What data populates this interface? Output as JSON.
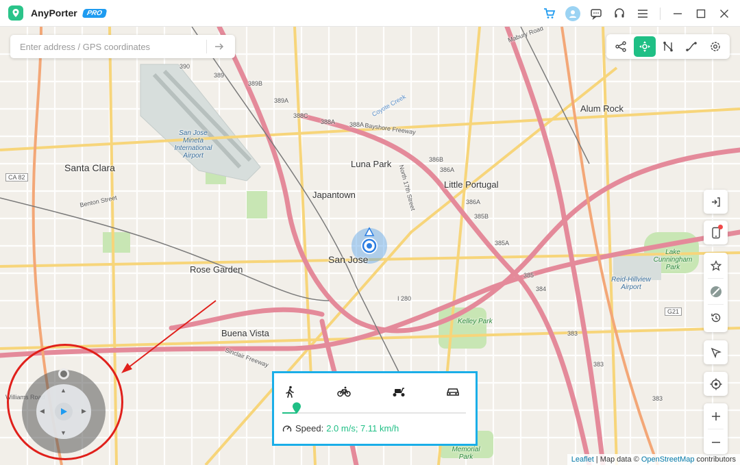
{
  "app": {
    "name": "AnyPorter",
    "badge": "PRO"
  },
  "search": {
    "placeholder": "Enter address / GPS coordinates",
    "value": ""
  },
  "map_labels": {
    "santa_clara": "Santa Clara",
    "san_jose": "San Jose",
    "luna_park": "Luna Park",
    "japantown": "Japantown",
    "little_portugal": "Little Portugal",
    "alum_rock": "Alum Rock",
    "rose_garden": "Rose Garden",
    "buena_vista": "Buena Vista",
    "lake_cunningham": "Lake Cunningham Park",
    "reid_hillview": "Reid-Hillview Airport",
    "kelley_park": "Kelley Park",
    "memorial_park": "Memorial Park",
    "airport": "San Jose Mineta International Airport",
    "bayshore": "Bayshore Freeway",
    "sinclair": "Sinclair Freeway",
    "i280": "I 280",
    "ca82": "CA 82",
    "g21": "G21",
    "benton": "Benton Street",
    "williams": "Williams Road",
    "n17th": "North 17th Street",
    "coyote": "Coyote Creek",
    "mabury": "Mabury Road",
    "r390": "390",
    "r389": "389",
    "r389b": "389B",
    "r389a": "389A",
    "r388c": "388C",
    "r388a_1": "388A",
    "r388a_2": "388A",
    "r386b": "386B",
    "r386a_1": "386A",
    "r386a_2": "386A",
    "r385b": "385B",
    "r385a": "385A",
    "r385": "385",
    "r384": "384",
    "r383_1": "383",
    "r383_2": "383",
    "r383_3": "383"
  },
  "speed": {
    "label": "Speed:",
    "value": "2.0 m/s; 7.11 km/h",
    "slider_fraction": 0.08,
    "modes": [
      "walk",
      "bike",
      "scooter",
      "car"
    ]
  },
  "attribution": {
    "leaflet": "Leaflet",
    "sep": " | Map data © ",
    "osm": "OpenStreetMap",
    "suffix": " contributors"
  },
  "colors": {
    "accent": "#1fbf85",
    "panel_border": "#1aaee8",
    "annotation": "#e0201b"
  }
}
